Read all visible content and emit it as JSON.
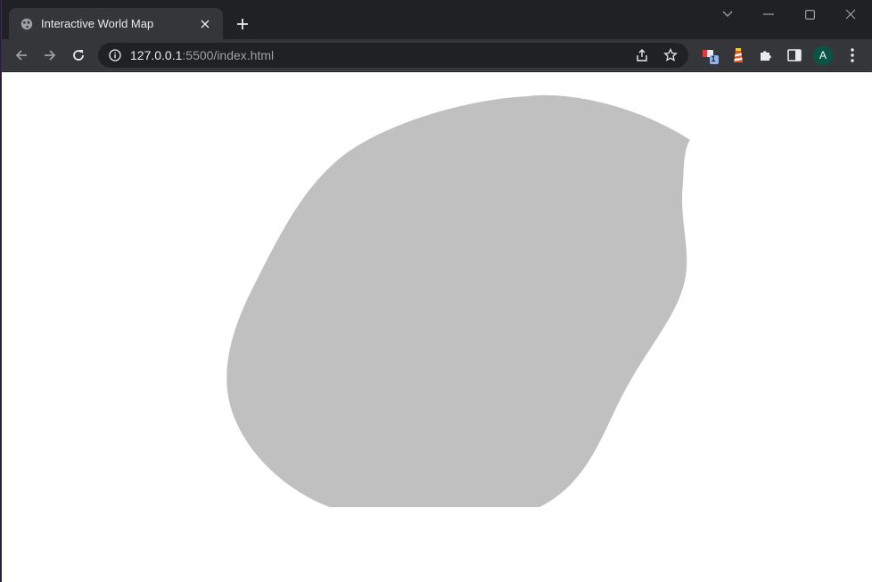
{
  "tab": {
    "title": "Interactive World Map",
    "favicon": "globe-icon"
  },
  "address_bar": {
    "host": "127.0.0.1",
    "path": ":5500/index.html"
  },
  "extensions": {
    "badge_count": "1"
  },
  "profile": {
    "initial": "A"
  },
  "colors": {
    "chrome_dark": "#202124",
    "toolbar": "#35363a",
    "map_fill": "#c0c0c0",
    "avatar_bg": "#0b5345",
    "badge_bg": "#8ab4f8"
  }
}
